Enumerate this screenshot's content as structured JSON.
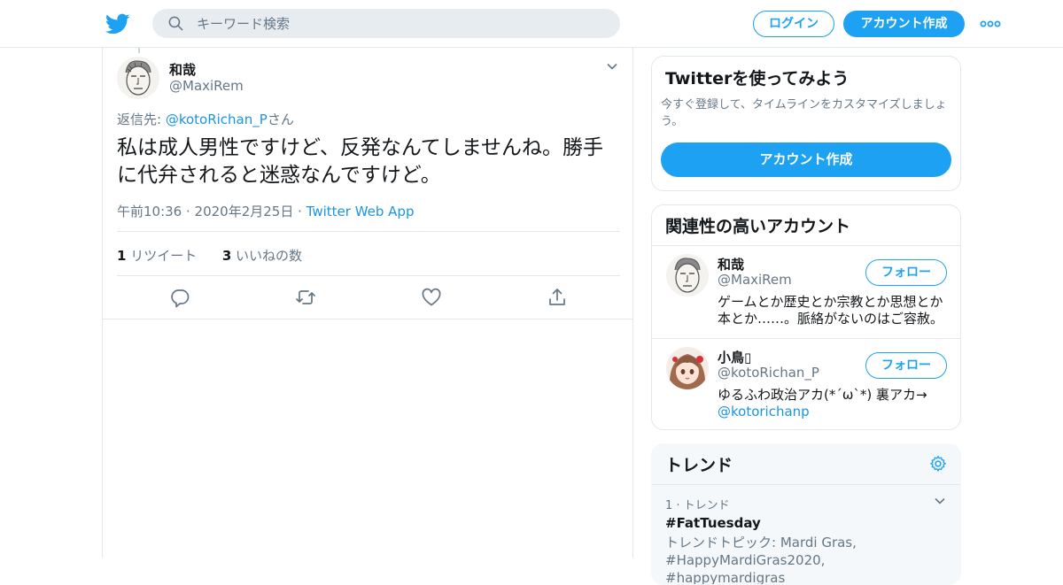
{
  "header": {
    "search_placeholder": "キーワード検索",
    "login_label": "ログイン",
    "signup_label": "アカウント作成"
  },
  "tweet": {
    "author_name": "和哉",
    "author_handle": "@MaxiRem",
    "reply_prefix": "返信先: ",
    "reply_handle": "@kotoRichan_P",
    "reply_suffix": "さん",
    "text": "私は成人男性ですけど、反発なんてしませんね。勝手に代弁されると迷惑なんですけど。",
    "timestamp": "午前10:36 · 2020年2月25日 · ",
    "source": "Twitter Web App",
    "retweet_count": "1",
    "retweet_label": " リツイート",
    "like_count": "3",
    "like_label": " いいねの数"
  },
  "signup_card": {
    "title": "Twitterを使ってみよう",
    "description": "今すぐ登録して、タイムラインをカスタマイズしましょう。",
    "button_label": "アカウント作成"
  },
  "related_accounts": {
    "title": "関連性の高いアカウント",
    "follow_label": "フォロー",
    "accounts": [
      {
        "name": "和哉",
        "handle": "@MaxiRem",
        "bio": "ゲームとか歴史とか宗教とか思想とか本とか……。脈絡がないのはご容赦。"
      },
      {
        "name": "小鳥▯",
        "handle": "@kotoRichan_P",
        "bio": "ゆるふわ政治アカ(*´ω`*) 裏アカ→",
        "bio_link": "@kotorichanp"
      }
    ]
  },
  "trends": {
    "title": "トレンド",
    "items": [
      {
        "rank": "1 · トレンド",
        "tag": "#FatTuesday",
        "topic": "トレンドトピック: Mardi Gras, #HappyMardiGras2020, #happymardigras"
      }
    ]
  },
  "colors": {
    "brand_blue": "#1da1f2",
    "link_blue": "#1b95e0",
    "muted_gray": "#657786",
    "border": "#e1e8ed"
  },
  "icons": [
    "twitter-bird-icon",
    "search-icon",
    "more-dots-icon",
    "chevron-down-icon",
    "reply-icon",
    "retweet-icon",
    "like-icon",
    "share-icon",
    "gear-icon"
  ]
}
